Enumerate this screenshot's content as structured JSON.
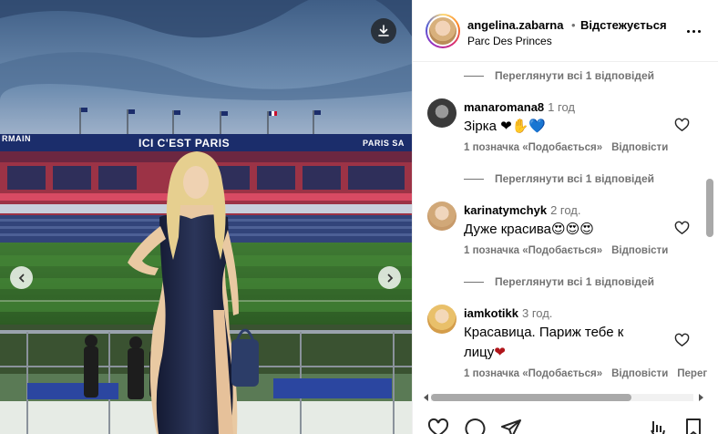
{
  "photo": {
    "banner_left": "RMAIN",
    "banner_center": "ICI C'EST PARIS",
    "banner_right": "PARIS SA"
  },
  "post_header": {
    "username": "angelina.zabarna",
    "separator": "•",
    "follow_status": "Відстежується",
    "location": "Parc Des Princes"
  },
  "comments": [
    {
      "view_replies": "Переглянути всі 1 відповідей"
    },
    {
      "username": "manaromana8",
      "time": "1 год",
      "text": "Зірка",
      "emoji": "❤✋💙",
      "likes": "1 позначка «Подобається»",
      "reply": "Відповісти",
      "view_replies": "Переглянути всі 1 відповідей"
    },
    {
      "username": "karinatymchyk",
      "time": "2 год.",
      "text": "Дуже красива",
      "emoji": "😍😍😍",
      "likes": "1 позначка «Подобається»",
      "reply": "Відповісти",
      "view_replies": "Переглянути всі 1 відповідей"
    },
    {
      "username": "iamkotikk",
      "time": "3 год.",
      "text": "Красавица. Париж тебе к лицу",
      "emoji": "❤",
      "likes": "1 позначка «Подобається»",
      "reply": "Відповісти",
      "more_reply": "Перег"
    }
  ],
  "colors": {
    "heart": "#b0151a",
    "muted": "#737373",
    "banner": "#1b2d6b"
  },
  "icons": [
    "download-icon",
    "chevron-left-icon",
    "chevron-right-icon",
    "more-icon",
    "heart-outline-icon",
    "comment-icon",
    "share-icon",
    "save-icon"
  ]
}
